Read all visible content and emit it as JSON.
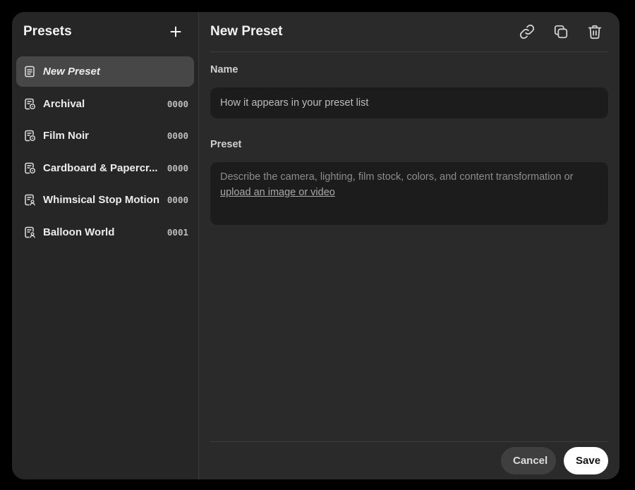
{
  "sidebar": {
    "title": "Presets",
    "add_icon": "plus-icon",
    "items": [
      {
        "label": "New Preset",
        "code": "",
        "icon": "document-icon",
        "selected": true
      },
      {
        "label": "Archival",
        "code": "0000",
        "icon": "film-doc-icon",
        "selected": false
      },
      {
        "label": "Film Noir",
        "code": "0000",
        "icon": "film-doc-icon",
        "selected": false
      },
      {
        "label": "Cardboard & Papercr...",
        "code": "0000",
        "icon": "film-doc-icon",
        "selected": false
      },
      {
        "label": "Whimsical Stop Motion",
        "code": "0000",
        "icon": "user-doc-icon",
        "selected": false
      },
      {
        "label": "Balloon World",
        "code": "0001",
        "icon": "user-doc-icon",
        "selected": false
      }
    ]
  },
  "main": {
    "title": "New Preset",
    "actions": [
      "link-icon",
      "copy-icon",
      "trash-icon"
    ],
    "name_field": {
      "label": "Name",
      "placeholder": "How it appears in your preset list",
      "value": ""
    },
    "preset_field": {
      "label": "Preset",
      "placeholder": "Describe the camera, lighting, film stock, colors, and content transformation or",
      "upload_link": "upload an image or video"
    }
  },
  "footer": {
    "cancel_label": "Cancel",
    "save_label": "Save"
  },
  "colors": {
    "background": "#000000",
    "modal": "#2a2a2a",
    "sidebar": "#262626",
    "selected_item": "#474747",
    "input_bg": "#1c1c1c",
    "save_button": "#ffffff",
    "cancel_button": "#3f3f3f"
  }
}
